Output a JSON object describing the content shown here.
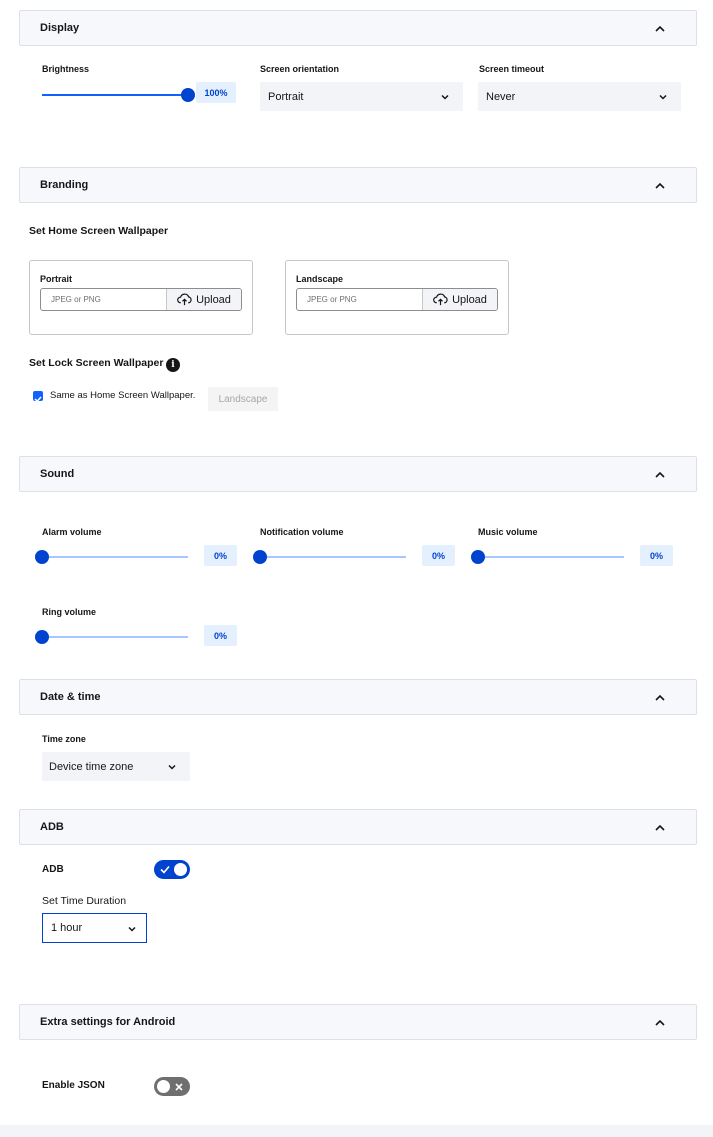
{
  "display": {
    "title": "Display",
    "brightness": {
      "label": "Brightness",
      "value_text": "100%",
      "fraction": 1.0
    },
    "orientation": {
      "label": "Screen orientation",
      "value": "Portrait"
    },
    "timeout": {
      "label": "Screen timeout",
      "value": "Never"
    }
  },
  "branding": {
    "title": "Branding",
    "home_wallpaper_title": "Set Home Screen Wallpaper",
    "portrait": {
      "title": "Portrait",
      "placeholder": "JPEG or PNG",
      "button": "Upload"
    },
    "landscape": {
      "title": "Landscape",
      "placeholder": "JPEG or PNG",
      "button": "Upload"
    },
    "lock_wallpaper_title": "Set Lock Screen Wallpaper",
    "same_as_home_label": "Same as Home Screen Wallpaper.",
    "same_as_home_checked": true,
    "landscape_button": "Landscape"
  },
  "sound": {
    "title": "Sound",
    "alarm": {
      "label": "Alarm volume",
      "value_text": "0%",
      "fraction": 0
    },
    "notification": {
      "label": "Notification volume",
      "value_text": "0%",
      "fraction": 0
    },
    "music": {
      "label": "Music volume",
      "value_text": "0%",
      "fraction": 0
    },
    "ring": {
      "label": "Ring volume",
      "value_text": "0%",
      "fraction": 0
    }
  },
  "datetime": {
    "title": "Date & time",
    "timezone": {
      "label": "Time zone",
      "value": "Device time zone"
    }
  },
  "adb": {
    "title": "ADB",
    "toggle_label": "ADB",
    "enabled": true,
    "duration_label": "Set Time Duration",
    "duration_value": "1 hour"
  },
  "extra": {
    "title": "Extra settings for Android",
    "json_label": "Enable JSON",
    "json_enabled": false
  },
  "colors": {
    "accent": "#0f62fe",
    "accent_dark": "#0043ce",
    "track": "#a6c8ff",
    "header_bg": "#f6f8fc",
    "toggle_off": "#6f6f6f"
  }
}
